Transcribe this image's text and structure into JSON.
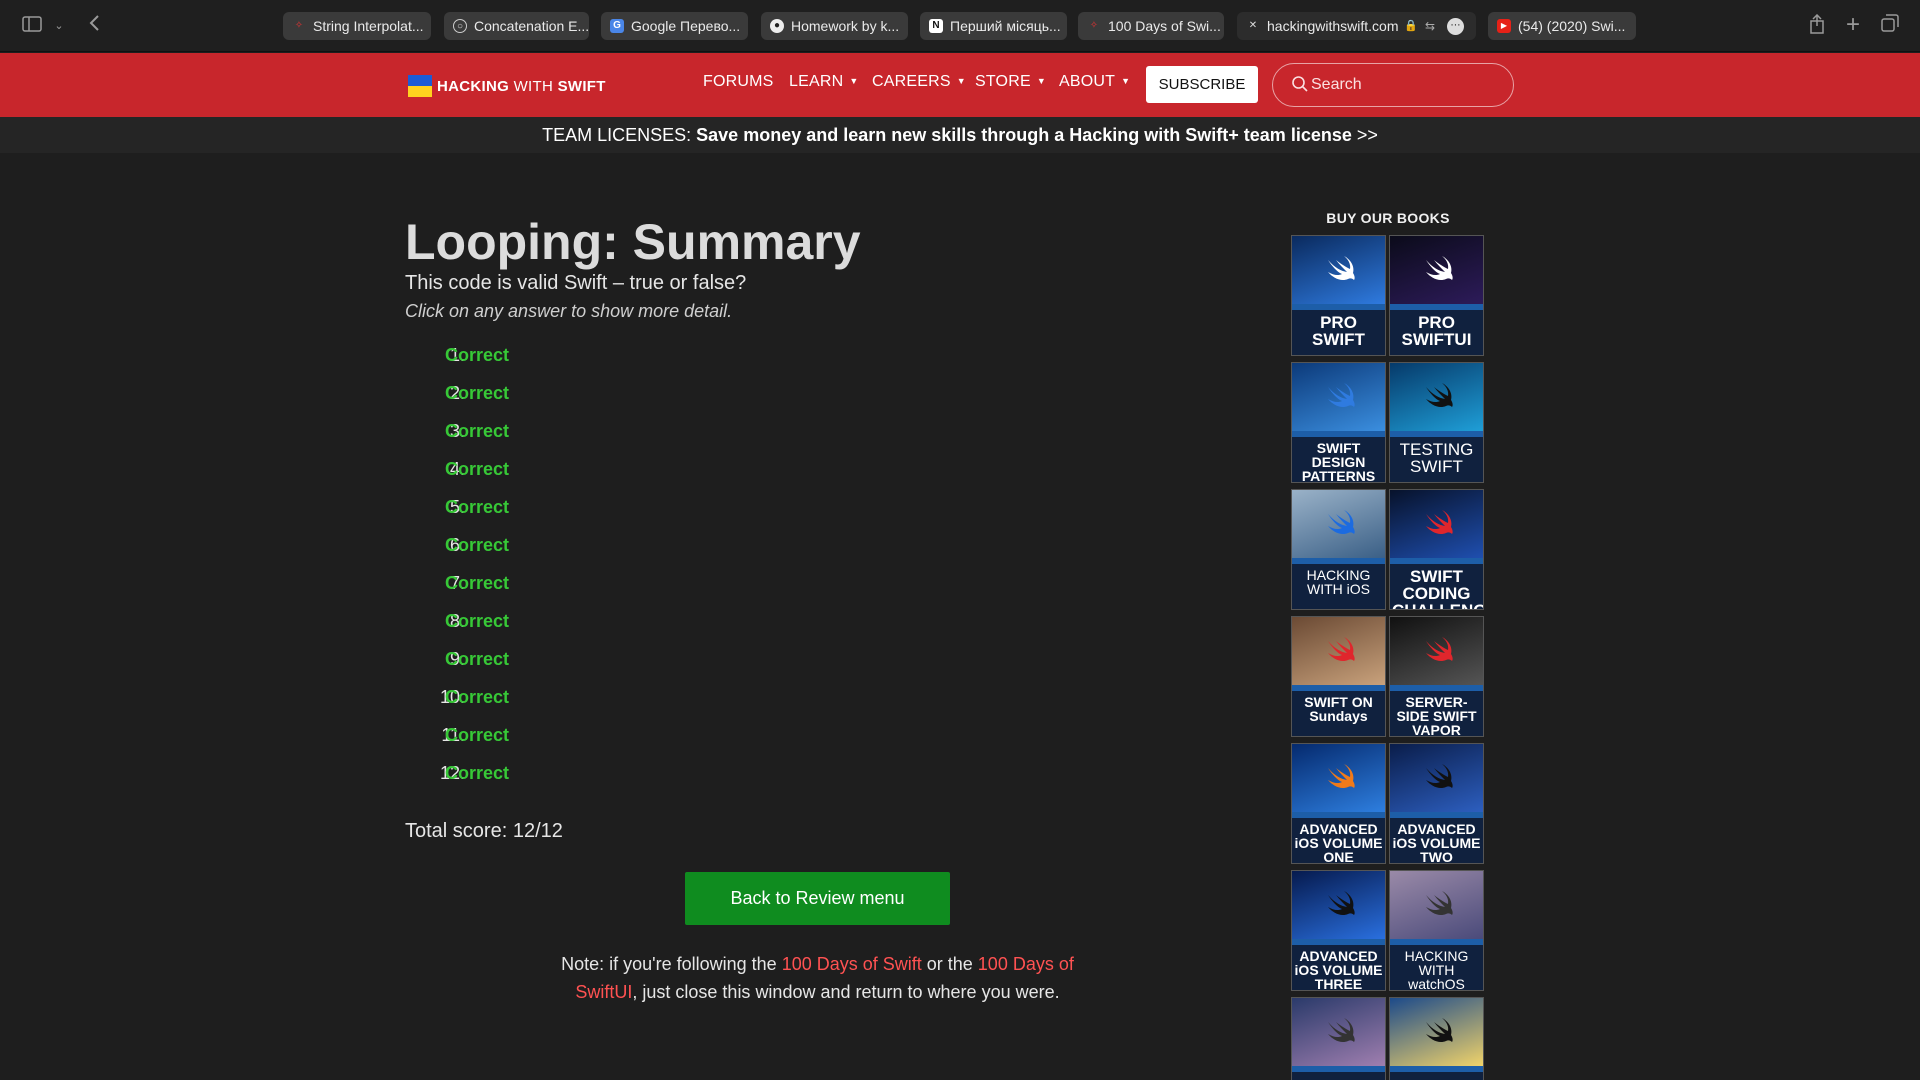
{
  "browser": {
    "tabs": [
      {
        "label": "String Interpolat...",
        "icon": "swift-red-icon"
      },
      {
        "label": "Concatenation E...",
        "icon": "chatgpt-icon"
      },
      {
        "label": "Google Перево...",
        "icon": "google-translate-icon"
      },
      {
        "label": "Homework by k...",
        "icon": "github-icon"
      },
      {
        "label": "Перший місяць...",
        "icon": "notion-icon"
      },
      {
        "label": "100 Days of Swi...",
        "icon": "swift-red-icon"
      },
      {
        "label": "hackingwithswift.com",
        "icon": "close-icon",
        "active": true
      },
      {
        "label": "(54) (2020) Swi...",
        "icon": "youtube-icon"
      }
    ]
  },
  "site": {
    "logo": {
      "bold1": "HACKING",
      "light": " WITH ",
      "bold2": "SWIFT"
    },
    "nav": [
      "FORUMS",
      "LEARN",
      "CAREERS",
      "STORE",
      "ABOUT"
    ],
    "subscribe": "SUBSCRIBE",
    "search_placeholder": "Search",
    "accent": "#c8262c"
  },
  "banner": {
    "prefix": "TEAM LICENSES: ",
    "message": "Save money and learn new skills through a Hacking with Swift+ team license",
    "suffix": " >>"
  },
  "quiz": {
    "title": "Looping: Summary",
    "question": "This code is valid Swift – true or false?",
    "hint": "Click on any answer to show more detail.",
    "answers": [
      {
        "num": "1.",
        "result": "Correct"
      },
      {
        "num": "2.",
        "result": "Correct"
      },
      {
        "num": "3.",
        "result": "Correct"
      },
      {
        "num": "4.",
        "result": "Correct"
      },
      {
        "num": "5.",
        "result": "Correct"
      },
      {
        "num": "6.",
        "result": "Correct"
      },
      {
        "num": "7.",
        "result": "Correct"
      },
      {
        "num": "8.",
        "result": "Correct"
      },
      {
        "num": "9.",
        "result": "Correct"
      },
      {
        "num": "10.",
        "result": "Correct"
      },
      {
        "num": "11.",
        "result": "Correct"
      },
      {
        "num": "12.",
        "result": "Correct"
      }
    ],
    "score_text": "Total score: 12/12",
    "back_button": "Back to Review menu",
    "note": {
      "part1": "Note: if you're following the ",
      "link1": "100 Days of Swift",
      "part2": " or the ",
      "link2": "100 Days of SwiftUI",
      "part3": ", just close this window and return to where you were."
    },
    "correct_color": "#37c837"
  },
  "sidebar": {
    "heading": "BUY OUR BOOKS",
    "books": [
      {
        "title": "PRO SWIFT"
      },
      {
        "title": "PRO SWIFTUI"
      },
      {
        "title": "SWIFT DESIGN PATTERNS"
      },
      {
        "title": "TESTING SWIFT"
      },
      {
        "title": "HACKING WITH iOS"
      },
      {
        "title": "SWIFT CODING CHALLENGES"
      },
      {
        "title": "SWIFT ON Sundays"
      },
      {
        "title": "SERVER-SIDE SWIFT VAPOR"
      },
      {
        "title": "ADVANCED iOS VOLUME ONE"
      },
      {
        "title": "ADVANCED iOS VOLUME TWO"
      },
      {
        "title": "ADVANCED iOS VOLUME THREE"
      },
      {
        "title": "HACKING WITH watchOS"
      },
      {
        "title": ""
      },
      {
        "title": ""
      }
    ]
  }
}
